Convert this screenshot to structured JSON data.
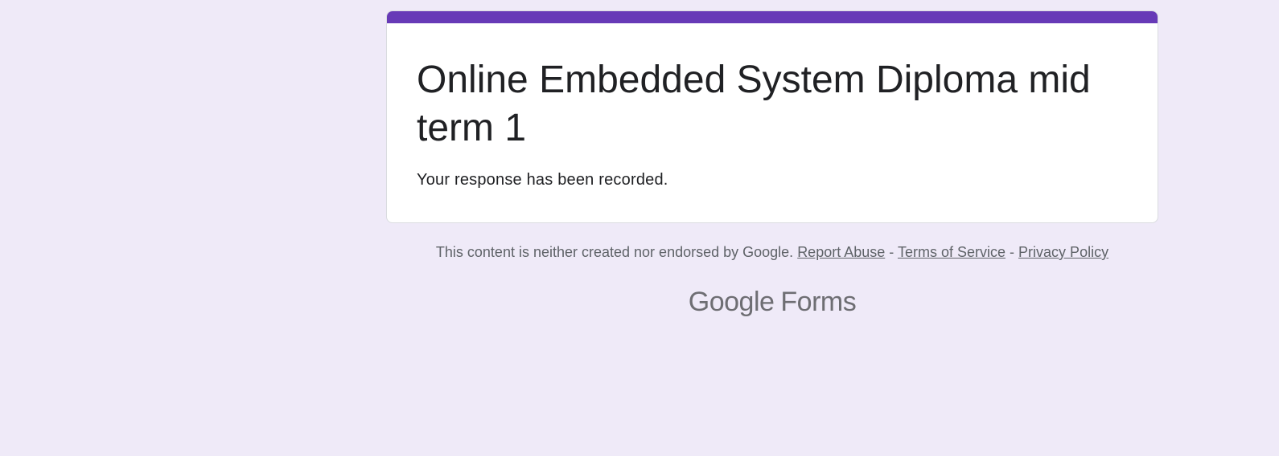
{
  "theme": {
    "accent_color": "#673ab7",
    "background_color": "#efeaf8",
    "card_color": "#ffffff",
    "text_color": "#202124",
    "muted_text_color": "#5f6368"
  },
  "form": {
    "title": "Online Embedded System Diploma mid term 1",
    "confirmation_message": "Your response has been recorded."
  },
  "footer": {
    "disclaimer_text": "This content is neither created nor endorsed by Google.",
    "separator": "-",
    "links": {
      "report_abuse": "Report Abuse",
      "terms_of_service": "Terms of Service",
      "privacy_policy": "Privacy Policy"
    },
    "logo": {
      "brand": "Google",
      "product": "Forms"
    }
  }
}
